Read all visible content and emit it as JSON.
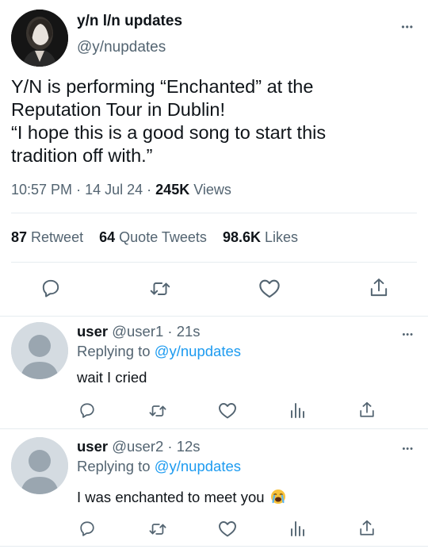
{
  "tweet": {
    "display_name": "y/n l/n updates",
    "handle": "@y/nupdates",
    "text_line1": "Y/N is performing “Enchanted” at the",
    "text_line2": "Reputation Tour in Dublin!",
    "text_line3": "“I hope this is a good song to start this",
    "text_line4": "tradition off with.”",
    "time": "10:57 PM",
    "date": "14 Jul 24",
    "separator": "·",
    "views_count": "245K",
    "views_label": "Views",
    "retweets_count": "87",
    "retweets_label": "Retweet",
    "quotes_count": "64",
    "quotes_label": "Quote Tweets",
    "likes_count": "98.6K",
    "likes_label": "Likes",
    "more_label": "•••"
  },
  "replies": [
    {
      "name": "user",
      "handle": "@user1",
      "time": "21s",
      "replying_prefix": "Replying to",
      "replying_to": "@y/nupdates",
      "text": "wait I cried",
      "emoji": ""
    },
    {
      "name": "user",
      "handle": "@user2",
      "time": "12s",
      "replying_prefix": "Replying to",
      "replying_to": "@y/nupdates",
      "text": "I was enchanted to meet you",
      "emoji": "😭"
    }
  ],
  "colors": {
    "accent": "#1d9bf0",
    "muted": "#536471",
    "text": "#0f1419",
    "divider": "#e6ecf0",
    "avatar_gray": "#a9b4bd",
    "avatar_bg": "#d4dbe1"
  },
  "icons": [
    "reply-icon",
    "retweet-icon",
    "like-icon",
    "share-icon",
    "analytics-icon",
    "more-icon"
  ]
}
